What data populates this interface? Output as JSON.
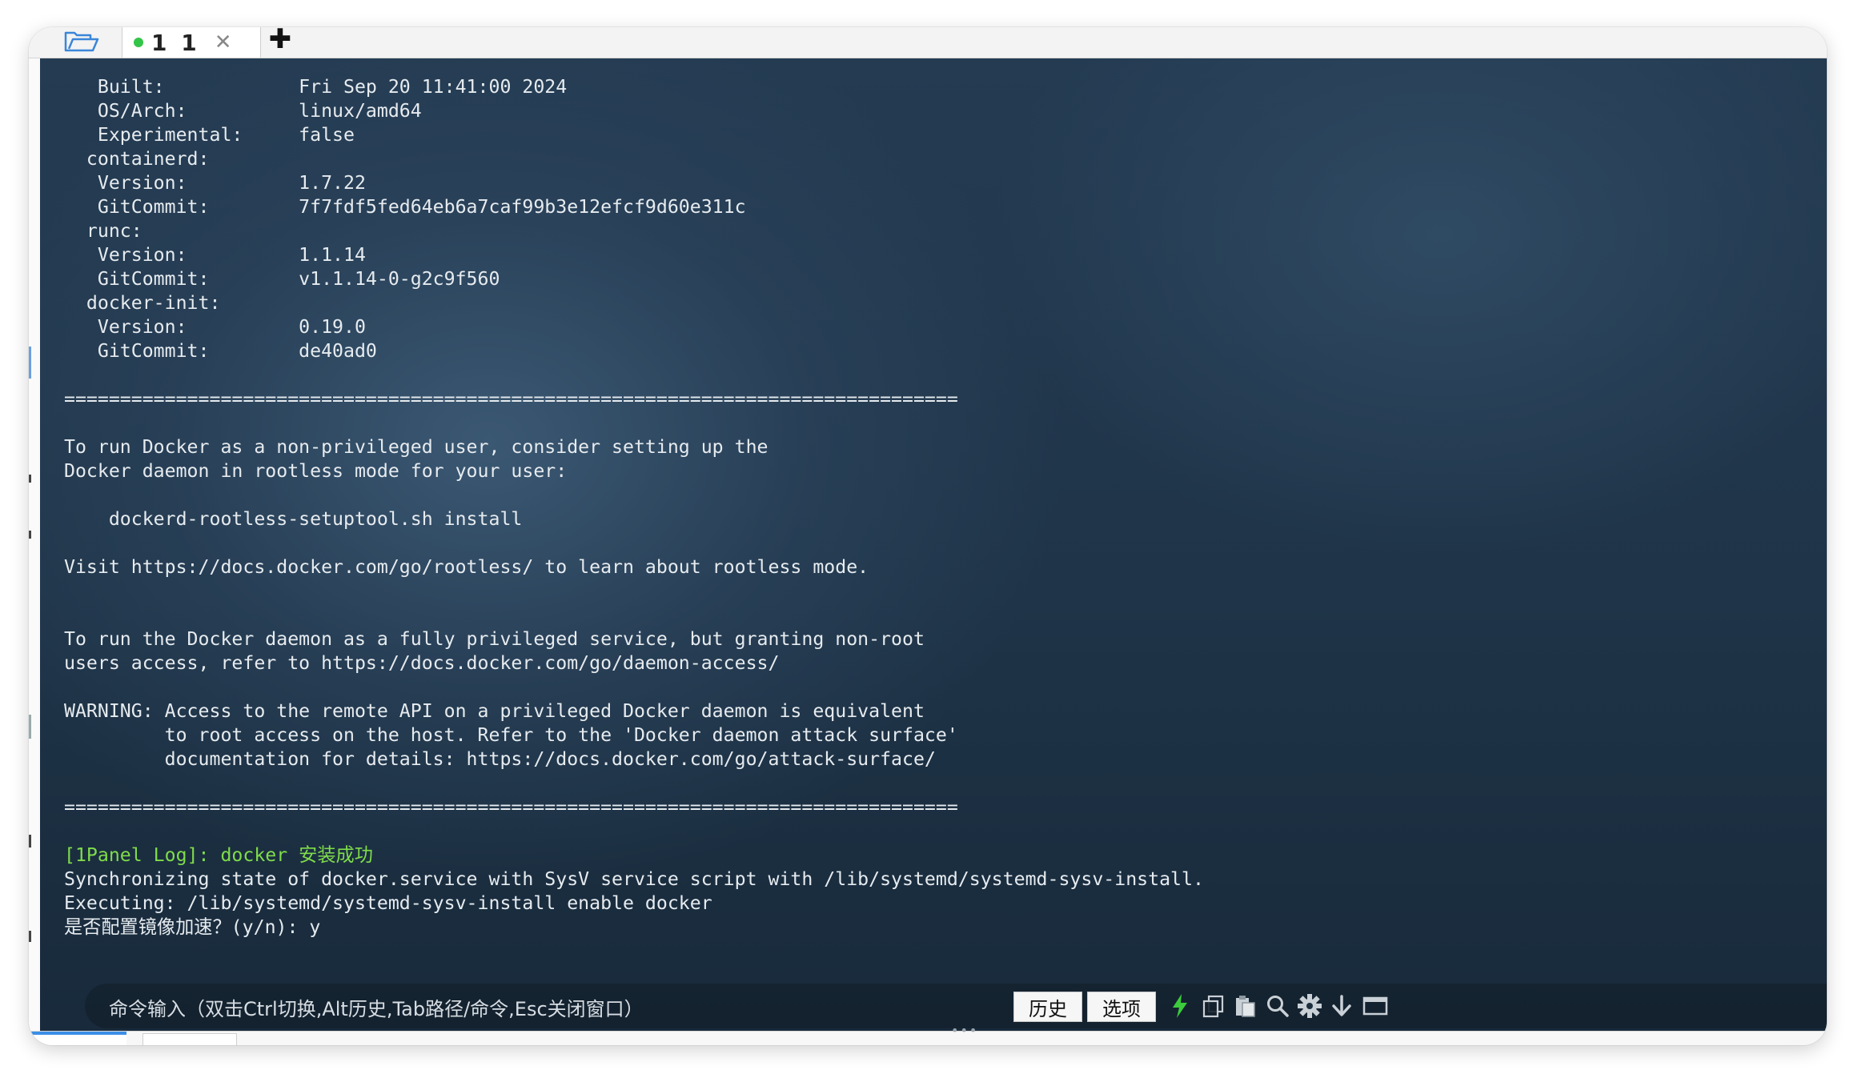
{
  "tabs": [
    {
      "label": "1 1",
      "active": true,
      "status_color": "#33c548"
    }
  ],
  "icons": {
    "folder": "folder-open-icon",
    "close": "close-icon",
    "add": "add-tab-icon",
    "lightning": "lightning-icon",
    "copy": "copy-icon",
    "paste": "paste-icon",
    "search": "search-icon",
    "settings": "gear-icon",
    "download": "arrow-down-icon",
    "window": "window-icon"
  },
  "terminal": {
    "lines": [
      {
        "text": "   Built:            Fri Sep 20 11:41:00 2024",
        "color": "default"
      },
      {
        "text": "   OS/Arch:          linux/amd64",
        "color": "default"
      },
      {
        "text": "   Experimental:     false",
        "color": "default"
      },
      {
        "text": "  containerd:",
        "color": "default"
      },
      {
        "text": "   Version:          1.7.22",
        "color": "default"
      },
      {
        "text": "   GitCommit:        7f7fdf5fed64eb6a7caf99b3e12efcf9d60e311c",
        "color": "default"
      },
      {
        "text": "  runc:",
        "color": "default"
      },
      {
        "text": "   Version:          1.1.14",
        "color": "default"
      },
      {
        "text": "   GitCommit:        v1.1.14-0-g2c9f560",
        "color": "default"
      },
      {
        "text": "  docker-init:",
        "color": "default"
      },
      {
        "text": "   Version:          0.19.0",
        "color": "default"
      },
      {
        "text": "   GitCommit:        de40ad0",
        "color": "default"
      },
      {
        "text": "",
        "color": "default"
      },
      {
        "text": "================================================================================",
        "color": "default"
      },
      {
        "text": "",
        "color": "default"
      },
      {
        "text": "To run Docker as a non-privileged user, consider setting up the",
        "color": "default"
      },
      {
        "text": "Docker daemon in rootless mode for your user:",
        "color": "default"
      },
      {
        "text": "",
        "color": "default"
      },
      {
        "text": "    dockerd-rootless-setuptool.sh install",
        "color": "default"
      },
      {
        "text": "",
        "color": "default"
      },
      {
        "text": "Visit https://docs.docker.com/go/rootless/ to learn about rootless mode.",
        "color": "default"
      },
      {
        "text": "",
        "color": "default"
      },
      {
        "text": "",
        "color": "default"
      },
      {
        "text": "To run the Docker daemon as a fully privileged service, but granting non-root",
        "color": "default"
      },
      {
        "text": "users access, refer to https://docs.docker.com/go/daemon-access/",
        "color": "default"
      },
      {
        "text": "",
        "color": "default"
      },
      {
        "text": "WARNING: Access to the remote API on a privileged Docker daemon is equivalent",
        "color": "default"
      },
      {
        "text": "         to root access on the host. Refer to the 'Docker daemon attack surface'",
        "color": "default"
      },
      {
        "text": "         documentation for details: https://docs.docker.com/go/attack-surface/",
        "color": "default"
      },
      {
        "text": "",
        "color": "default"
      },
      {
        "text": "================================================================================",
        "color": "default"
      },
      {
        "text": "",
        "color": "default"
      },
      {
        "text": "[1Panel Log]: docker 安装成功",
        "color": "green"
      },
      {
        "text": "Synchronizing state of docker.service with SysV service script with /lib/systemd/systemd-sysv-install.",
        "color": "default"
      },
      {
        "text": "Executing: /lib/systemd/systemd-sysv-install enable docker",
        "color": "default"
      },
      {
        "text": "是否配置镜像加速？(y/n): y",
        "color": "default"
      }
    ]
  },
  "command_bar": {
    "placeholder": "命令输入（双击Ctrl切换,Alt历史,Tab路径/命令,Esc关闭窗口）",
    "history_label": "历史",
    "options_label": "选项"
  },
  "colors": {
    "log_green": "#7fdc4a",
    "terminal_text": "#e6ebef",
    "lightning": "#3ccb3c"
  }
}
